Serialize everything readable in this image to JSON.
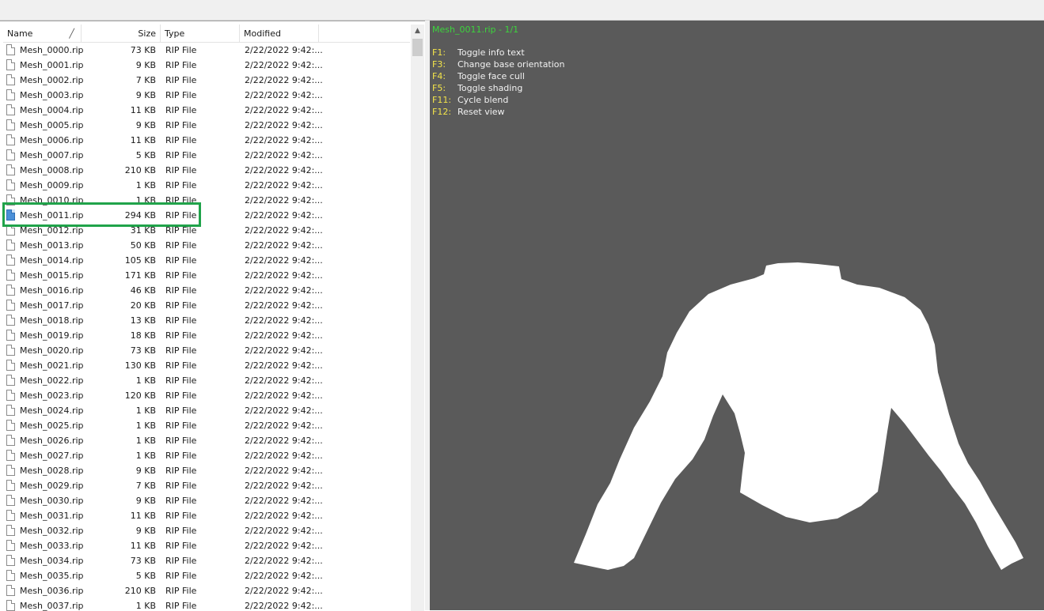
{
  "header": {
    "name": "Name",
    "size": "Size",
    "type": "Type",
    "modified": "Modified"
  },
  "files": [
    {
      "name": "Mesh_0000.rip",
      "size": "73 KB",
      "type": "RIP File",
      "modified": "2/22/2022 9:42:..."
    },
    {
      "name": "Mesh_0001.rip",
      "size": "9 KB",
      "type": "RIP File",
      "modified": "2/22/2022 9:42:..."
    },
    {
      "name": "Mesh_0002.rip",
      "size": "7 KB",
      "type": "RIP File",
      "modified": "2/22/2022 9:42:..."
    },
    {
      "name": "Mesh_0003.rip",
      "size": "9 KB",
      "type": "RIP File",
      "modified": "2/22/2022 9:42:..."
    },
    {
      "name": "Mesh_0004.rip",
      "size": "11 KB",
      "type": "RIP File",
      "modified": "2/22/2022 9:42:..."
    },
    {
      "name": "Mesh_0005.rip",
      "size": "9 KB",
      "type": "RIP File",
      "modified": "2/22/2022 9:42:..."
    },
    {
      "name": "Mesh_0006.rip",
      "size": "11 KB",
      "type": "RIP File",
      "modified": "2/22/2022 9:42:..."
    },
    {
      "name": "Mesh_0007.rip",
      "size": "5 KB",
      "type": "RIP File",
      "modified": "2/22/2022 9:42:..."
    },
    {
      "name": "Mesh_0008.rip",
      "size": "210 KB",
      "type": "RIP File",
      "modified": "2/22/2022 9:42:..."
    },
    {
      "name": "Mesh_0009.rip",
      "size": "1 KB",
      "type": "RIP File",
      "modified": "2/22/2022 9:42:..."
    },
    {
      "name": "Mesh_0010.rip",
      "size": "1 KB",
      "type": "RIP File",
      "modified": "2/22/2022 9:42:..."
    },
    {
      "name": "Mesh_0011.rip",
      "size": "294 KB",
      "type": "RIP File",
      "modified": "2/22/2022 9:42:...",
      "selected": true
    },
    {
      "name": "Mesh_0012.rip",
      "size": "31 KB",
      "type": "RIP File",
      "modified": "2/22/2022 9:42:..."
    },
    {
      "name": "Mesh_0013.rip",
      "size": "50 KB",
      "type": "RIP File",
      "modified": "2/22/2022 9:42:..."
    },
    {
      "name": "Mesh_0014.rip",
      "size": "105 KB",
      "type": "RIP File",
      "modified": "2/22/2022 9:42:..."
    },
    {
      "name": "Mesh_0015.rip",
      "size": "171 KB",
      "type": "RIP File",
      "modified": "2/22/2022 9:42:..."
    },
    {
      "name": "Mesh_0016.rip",
      "size": "46 KB",
      "type": "RIP File",
      "modified": "2/22/2022 9:42:..."
    },
    {
      "name": "Mesh_0017.rip",
      "size": "20 KB",
      "type": "RIP File",
      "modified": "2/22/2022 9:42:..."
    },
    {
      "name": "Mesh_0018.rip",
      "size": "13 KB",
      "type": "RIP File",
      "modified": "2/22/2022 9:42:..."
    },
    {
      "name": "Mesh_0019.rip",
      "size": "18 KB",
      "type": "RIP File",
      "modified": "2/22/2022 9:42:..."
    },
    {
      "name": "Mesh_0020.rip",
      "size": "73 KB",
      "type": "RIP File",
      "modified": "2/22/2022 9:42:..."
    },
    {
      "name": "Mesh_0021.rip",
      "size": "130 KB",
      "type": "RIP File",
      "modified": "2/22/2022 9:42:..."
    },
    {
      "name": "Mesh_0022.rip",
      "size": "1 KB",
      "type": "RIP File",
      "modified": "2/22/2022 9:42:..."
    },
    {
      "name": "Mesh_0023.rip",
      "size": "120 KB",
      "type": "RIP File",
      "modified": "2/22/2022 9:42:..."
    },
    {
      "name": "Mesh_0024.rip",
      "size": "1 KB",
      "type": "RIP File",
      "modified": "2/22/2022 9:42:..."
    },
    {
      "name": "Mesh_0025.rip",
      "size": "1 KB",
      "type": "RIP File",
      "modified": "2/22/2022 9:42:..."
    },
    {
      "name": "Mesh_0026.rip",
      "size": "1 KB",
      "type": "RIP File",
      "modified": "2/22/2022 9:42:..."
    },
    {
      "name": "Mesh_0027.rip",
      "size": "1 KB",
      "type": "RIP File",
      "modified": "2/22/2022 9:42:..."
    },
    {
      "name": "Mesh_0028.rip",
      "size": "9 KB",
      "type": "RIP File",
      "modified": "2/22/2022 9:42:..."
    },
    {
      "name": "Mesh_0029.rip",
      "size": "7 KB",
      "type": "RIP File",
      "modified": "2/22/2022 9:42:..."
    },
    {
      "name": "Mesh_0030.rip",
      "size": "9 KB",
      "type": "RIP File",
      "modified": "2/22/2022 9:42:..."
    },
    {
      "name": "Mesh_0031.rip",
      "size": "11 KB",
      "type": "RIP File",
      "modified": "2/22/2022 9:42:..."
    },
    {
      "name": "Mesh_0032.rip",
      "size": "9 KB",
      "type": "RIP File",
      "modified": "2/22/2022 9:42:..."
    },
    {
      "name": "Mesh_0033.rip",
      "size": "11 KB",
      "type": "RIP File",
      "modified": "2/22/2022 9:42:..."
    },
    {
      "name": "Mesh_0034.rip",
      "size": "73 KB",
      "type": "RIP File",
      "modified": "2/22/2022 9:42:..."
    },
    {
      "name": "Mesh_0035.rip",
      "size": "5 KB",
      "type": "RIP File",
      "modified": "2/22/2022 9:42:..."
    },
    {
      "name": "Mesh_0036.rip",
      "size": "210 KB",
      "type": "RIP File",
      "modified": "2/22/2022 9:42:..."
    },
    {
      "name": "Mesh_0037.rip",
      "size": "1 KB",
      "type": "RIP File",
      "modified": "2/22/2022 9:42:..."
    }
  ],
  "viewer": {
    "title": "Mesh_0011.rip - 1/1",
    "shortcuts": [
      {
        "key": "F1:",
        "label": "Toggle info text"
      },
      {
        "key": "F3:",
        "label": "Change base orientation"
      },
      {
        "key": "F4:",
        "label": "Toggle face cull"
      },
      {
        "key": "F5:",
        "label": "Toggle shading"
      },
      {
        "key": "F11:",
        "label": "Cycle blend"
      },
      {
        "key": "F12:",
        "label": "Reset view"
      }
    ]
  },
  "colors": {
    "viewer_bg": "#5a5a5a",
    "title_green": "#3cd43c",
    "key_yellow": "#f3e44a",
    "highlight_green": "#20a34a",
    "mesh_fill": "#ffffff"
  }
}
